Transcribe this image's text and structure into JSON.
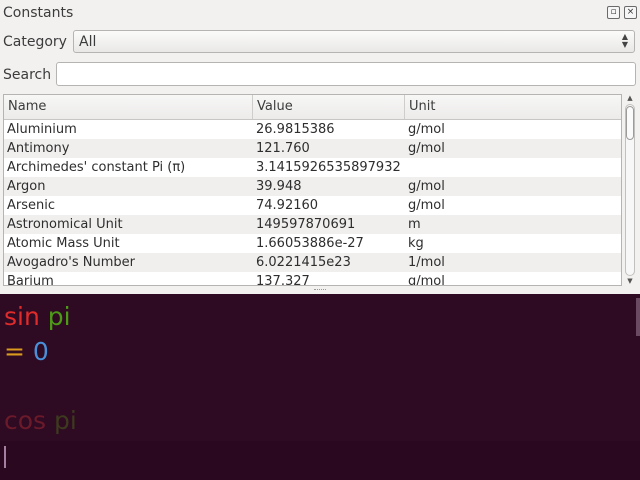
{
  "panel": {
    "title": "Constants",
    "category_label": "Category",
    "category_value": "All",
    "search_label": "Search",
    "search_value": ""
  },
  "table": {
    "headers": [
      "Name",
      "Value",
      "Unit"
    ],
    "rows": [
      [
        "Aluminium",
        "26.9815386",
        "g/mol"
      ],
      [
        "Antimony",
        "121.760",
        "g/mol"
      ],
      [
        "Archimedes' constant Pi (π)",
        "3.1415926535897932",
        ""
      ],
      [
        "Argon",
        "39.948",
        "g/mol"
      ],
      [
        "Arsenic",
        "74.92160",
        "g/mol"
      ],
      [
        "Astronomical Unit",
        "149597870691",
        "m"
      ],
      [
        "Atomic Mass Unit",
        "1.66053886e-27",
        "kg"
      ],
      [
        "Avogadro's Number",
        "6.0221415e23",
        "1/mol"
      ],
      [
        "Barium",
        "137.327",
        "g/mol"
      ]
    ]
  },
  "calc": {
    "expr1_func": "sin",
    "expr1_arg": "pi",
    "result1_eq": "=",
    "result1_val": "0",
    "expr2_func": "cos",
    "expr2_arg": "pi",
    "input_value": ""
  },
  "colors": {
    "calc_background": "#2e0a23",
    "function": "#e02b2b",
    "variable": "#4c9a16",
    "equals": "#d99a1d",
    "number": "#4a90d9"
  }
}
